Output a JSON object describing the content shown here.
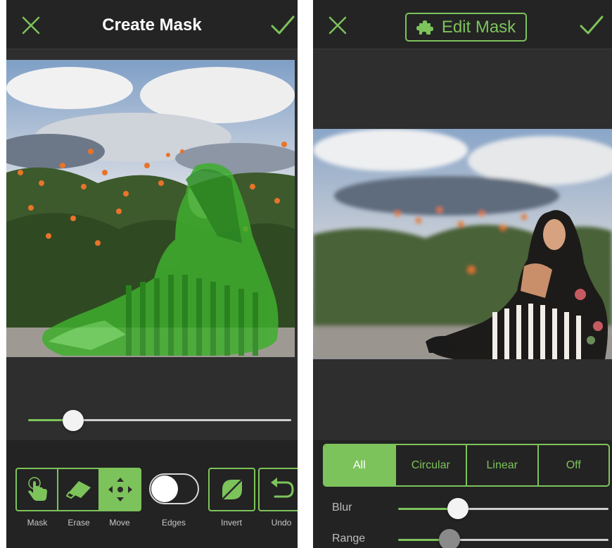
{
  "colors": {
    "accent": "#7dc35b",
    "panel_bg": "#2e2e2e",
    "toolbar_bg": "#232323",
    "mask_overlay": "#3fae2e"
  },
  "left_screen": {
    "title": "Create Mask",
    "cancel_icon": "close-icon",
    "confirm_icon": "checkmark-icon",
    "slider_value": 0.17,
    "tools": [
      {
        "label": "Mask",
        "icon": "hand-pointer-icon",
        "active": false
      },
      {
        "label": "Erase",
        "icon": "eraser-icon",
        "active": false
      },
      {
        "label": "Move",
        "icon": "move-arrows-icon",
        "active": true
      }
    ],
    "edges": {
      "label": "Edges",
      "on": false
    },
    "invert": {
      "label": "Invert",
      "icon": "invert-leaf-icon"
    },
    "undo": {
      "label": "Undo",
      "icon": "undo-icon"
    }
  },
  "right_screen": {
    "title": "Edit Mask",
    "title_icon": "puzzle-icon",
    "cancel_icon": "close-icon",
    "confirm_icon": "checkmark-icon",
    "modes": [
      "All",
      "Circular",
      "Linear",
      "Off"
    ],
    "active_mode": "All",
    "blur": {
      "label": "Blur",
      "value": 0.28
    },
    "range": {
      "label": "Range",
      "value": 0.24
    }
  }
}
